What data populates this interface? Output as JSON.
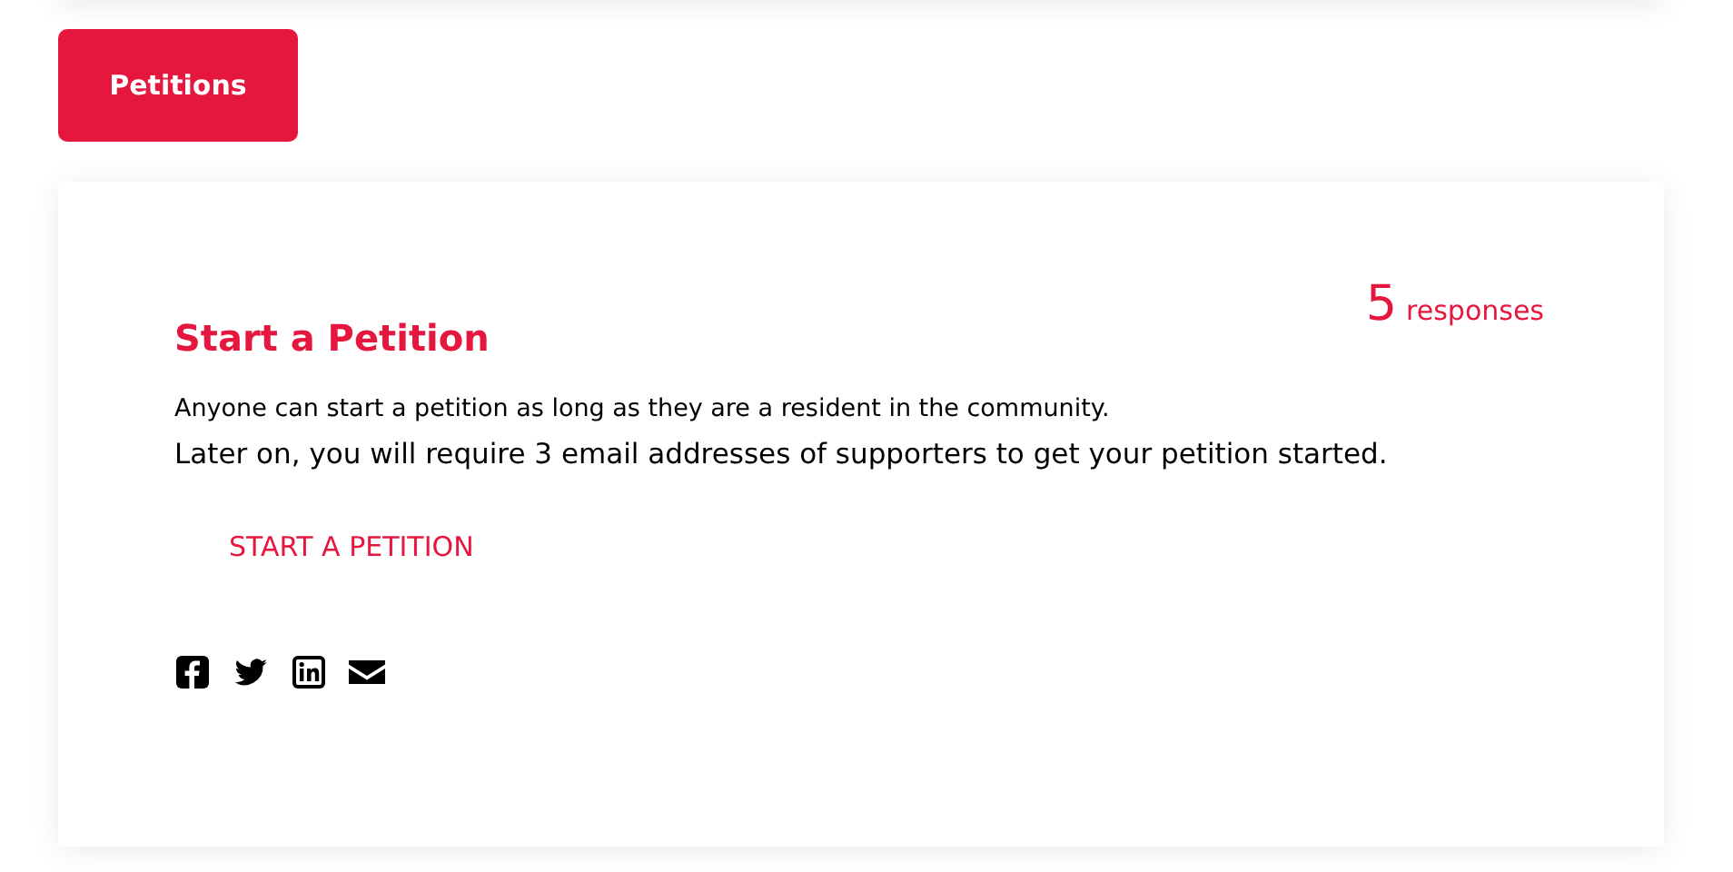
{
  "tab_button": {
    "label": "Petitions"
  },
  "card": {
    "title": "Start a Petition",
    "count": "5",
    "count_label": "responses",
    "paragraphs": [
      "Anyone can start a petition as long as they are a resident in the community.",
      "Later on, you will require 3 email addresses of supporters to get your petition started."
    ],
    "action": "START A PETITION",
    "share": [
      {
        "kind": "facebook"
      },
      {
        "kind": "twitter"
      },
      {
        "kind": "linkedin"
      },
      {
        "kind": "email"
      }
    ]
  }
}
